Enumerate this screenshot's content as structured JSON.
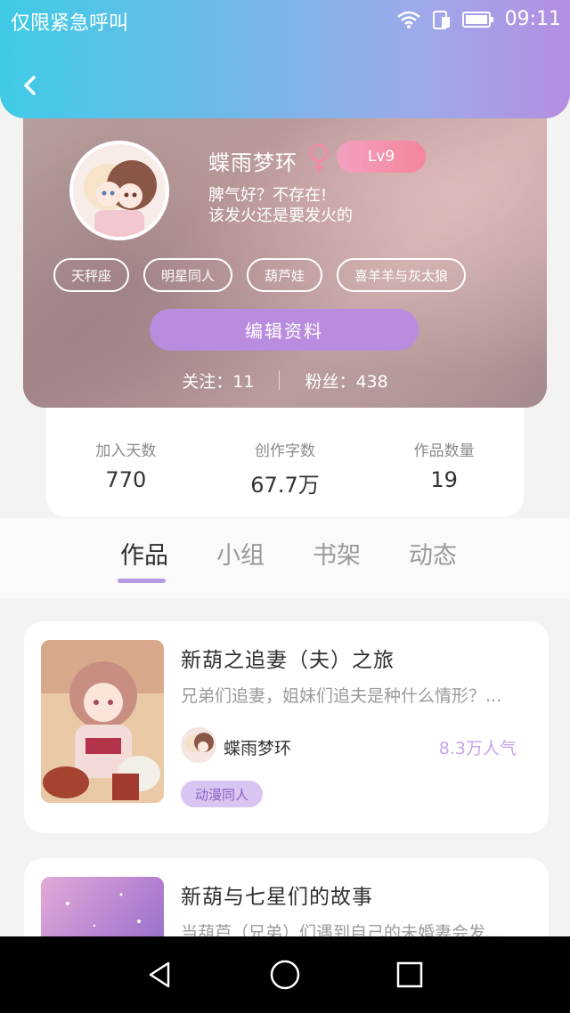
{
  "status_bar": {
    "carrier": "仅限紧急呼叫",
    "time": "09:11",
    "icons": [
      "wifi-icon",
      "sim-icon",
      "battery-icon"
    ]
  },
  "header": {
    "back_icon": "chevron-left-icon"
  },
  "profile": {
    "username": "蝶雨梦环",
    "gender_icon": "female-icon",
    "level": "Lv9",
    "bio_line1": "脾气好？不存在!",
    "bio_line2": "该发火还是要发火的",
    "tags": [
      "天秤座",
      "明星同人",
      "葫芦娃",
      "喜羊羊与灰太狼"
    ],
    "edit_button": "编辑资料",
    "following": "关注：11",
    "followers": "粉丝：438"
  },
  "stats": [
    {
      "label": "加入天数",
      "value": "770"
    },
    {
      "label": "创作字数",
      "value": "67.7万"
    },
    {
      "label": "作品数量",
      "value": "19"
    }
  ],
  "tabs": [
    "作品",
    "小组",
    "书架",
    "动态"
  ],
  "active_tab": "作品",
  "works": [
    {
      "title": "新葫之追妻（夫）之旅",
      "description": "兄弟们追妻，姐妹们追夫是种什么情形？...",
      "author": "蝶雨梦环",
      "popularity": "8.3万人气",
      "genre": "动漫同人"
    },
    {
      "title": "新葫与七星们的故事",
      "description": "当葫芦（兄弟）们遇到自己的未婚妻会发..."
    }
  ],
  "colors": {
    "header_gradient_start": "#3fcbe6",
    "header_gradient_end": "#b48ee2",
    "accent_purple": "#b98ce0",
    "level_pink": "#f5859a",
    "popularity_purple": "#c6a3e8"
  },
  "navbar": [
    "back-triangle-icon",
    "home-circle-icon",
    "recents-square-icon"
  ]
}
